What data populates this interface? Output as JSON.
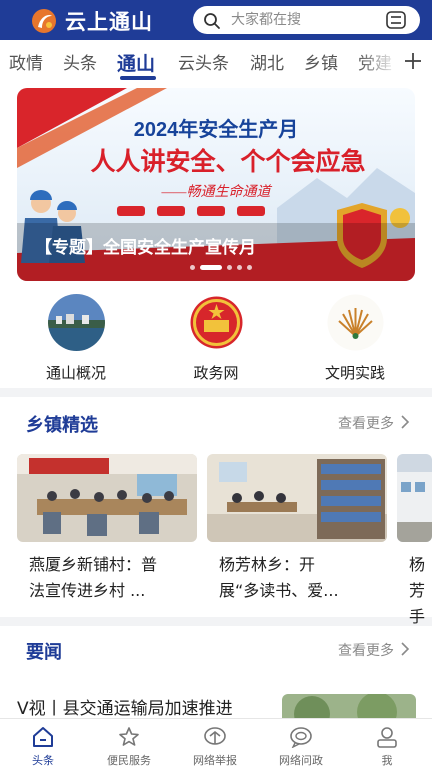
{
  "header": {
    "app_name": "云上通山",
    "search_placeholder": "大家都在搜",
    "brand_color": "#1f3c97"
  },
  "tabs": [
    {
      "label": "政情",
      "active": false
    },
    {
      "label": "头条",
      "active": false
    },
    {
      "label": "通山",
      "active": true
    },
    {
      "label": "云头条",
      "active": false
    },
    {
      "label": "湖北",
      "active": false
    },
    {
      "label": "乡镇",
      "active": false
    },
    {
      "label": "党建",
      "active": false
    }
  ],
  "banner": {
    "title_line1": "2024年安全生产月",
    "title_line2": "人人讲安全、个个会应急",
    "title_line3": "——畅通生命通道",
    "caption": "【专题】全国安全生产宣传月",
    "slide_count": 5,
    "active_slide": 2
  },
  "shortcuts": [
    {
      "label": "通山概况",
      "icon": "county-photo-icon"
    },
    {
      "label": "政务网",
      "icon": "national-emblem-icon"
    },
    {
      "label": "文明实践",
      "icon": "civilization-practice-icon"
    }
  ],
  "towns": {
    "title": "乡镇精选",
    "more": "查看更多",
    "cards": [
      {
        "line1": "燕厦乡新铺村：普",
        "line2": "法宣传进乡村 ..."
      },
      {
        "line1": "杨芳林乡：开",
        "line2": "展“多读书、爱..."
      },
      {
        "line1": "杨芳",
        "line2": "手户"
      }
    ]
  },
  "news": {
    "title": "要闻",
    "more": "查看更多",
    "headline": "V视丨县交通运输局加速推进"
  },
  "bottom_nav": [
    {
      "label": "头条",
      "icon": "home-icon",
      "active": true
    },
    {
      "label": "便民服务",
      "icon": "service-icon",
      "active": false
    },
    {
      "label": "网络举报",
      "icon": "report-icon",
      "active": false
    },
    {
      "label": "网络问政",
      "icon": "inquiry-icon",
      "active": false
    },
    {
      "label": "我",
      "icon": "user-icon",
      "active": false
    }
  ]
}
